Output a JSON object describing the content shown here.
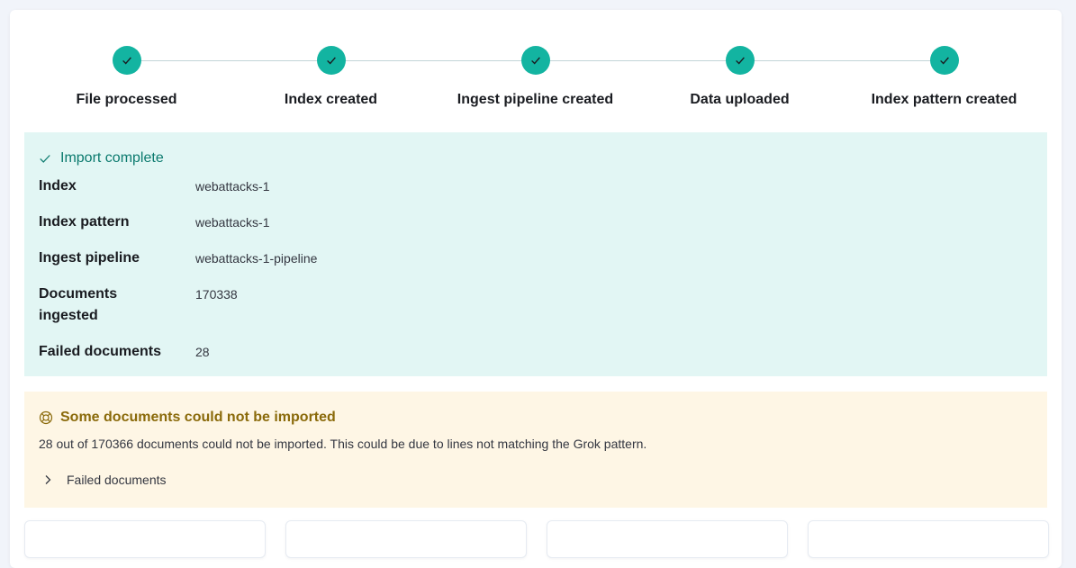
{
  "steps": [
    {
      "title": "File processed"
    },
    {
      "title": "Index created"
    },
    {
      "title": "Ingest pipeline created"
    },
    {
      "title": "Data uploaded"
    },
    {
      "title": "Index pattern created"
    }
  ],
  "import_summary": {
    "title": "Import complete",
    "rows": [
      {
        "label": "Index",
        "value": "webattacks-1"
      },
      {
        "label": "Index pattern",
        "value": "webattacks-1"
      },
      {
        "label": "Ingest pipeline",
        "value": "webattacks-1-pipeline"
      },
      {
        "label": "Documents ingested",
        "value": "170338"
      },
      {
        "label": "Failed documents",
        "value": "28"
      }
    ]
  },
  "warning": {
    "title": "Some documents could not be imported",
    "message": "28 out of 170366 documents could not be imported. This could be due to lines not matching the Grok pattern.",
    "accordion_label": "Failed documents"
  },
  "colors": {
    "step_complete": "#13b4a1",
    "success_bg": "#e2f6f4",
    "success_text": "#0b7a6e",
    "warning_bg": "#fef6e5",
    "warning_text": "#8a6a0a"
  }
}
